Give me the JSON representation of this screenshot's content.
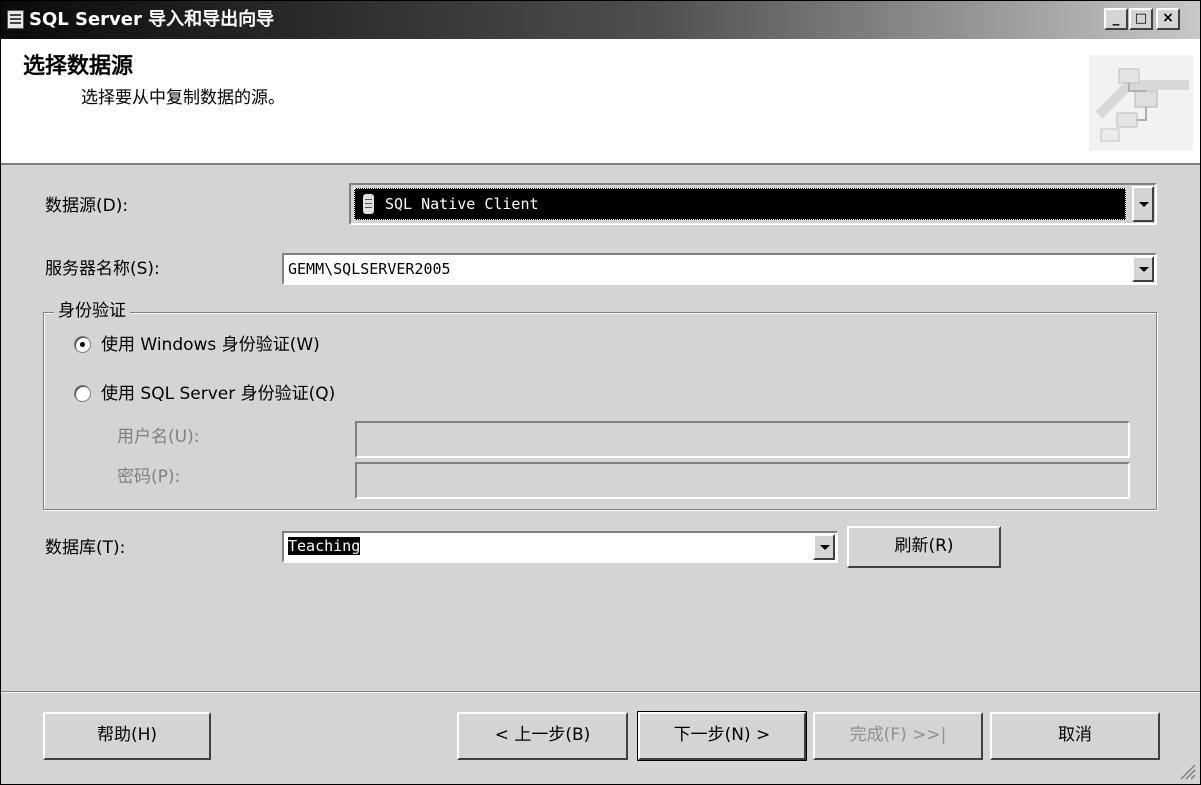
{
  "window": {
    "title": "SQL Server 导入和导出向导",
    "controls": [
      "_",
      "□",
      "×"
    ]
  },
  "header": {
    "title": "选择数据源",
    "subtitle": "选择要从中复制数据的源。"
  },
  "data_source": {
    "label": "数据源(D):",
    "value": "SQL Native Client"
  },
  "server": {
    "label": "服务器名称(S):",
    "value": "GEMM\\SQLSERVER2005"
  },
  "auth": {
    "group_label": "身份验证",
    "windows_label": "使用 Windows 身份验证(W)",
    "sql_label": "使用 SQL Server 身份验证(Q)",
    "selected": "windows",
    "username_label": "用户名(U):",
    "password_label": "密码(P):"
  },
  "database": {
    "label": "数据库(T):",
    "value": "Teaching",
    "refresh_label": "刷新(R)"
  },
  "footer": {
    "help": "帮助(H)",
    "back": "< 上一步(B)",
    "next": "下一步(N) >",
    "finish": "完成(F) >>|",
    "cancel": "取消"
  },
  "icons": {
    "app": "wizard-app-icon",
    "header": "data-transfer-graphic",
    "datasource": "database-icon"
  }
}
